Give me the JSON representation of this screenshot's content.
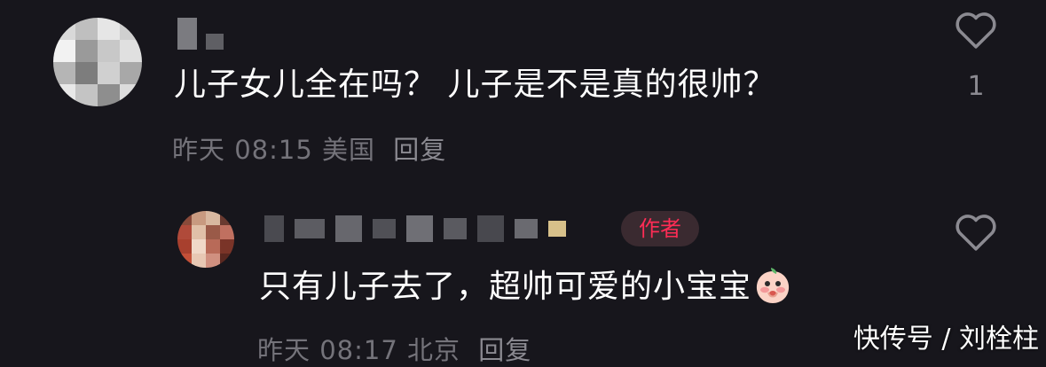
{
  "comments": [
    {
      "text": "儿子女儿全在吗？ 儿子是不是真的很帅？",
      "time": "昨天 08:15",
      "location": "美国",
      "reply_label": "回复",
      "like_count": "1"
    },
    {
      "badge": "作者",
      "text": "只有儿子去了，超帅可爱的小宝宝",
      "emoji": "blushing-peach-emoji",
      "time": "昨天 08:17",
      "location": "北京",
      "reply_label": "回复"
    }
  ],
  "watermark": "快传号 / 刘栓柱",
  "colors": {
    "background": "#17161c",
    "author_badge_text": "#fe2c55",
    "author_badge_bg": "#3a2a30",
    "meta_text": "#74737a"
  }
}
